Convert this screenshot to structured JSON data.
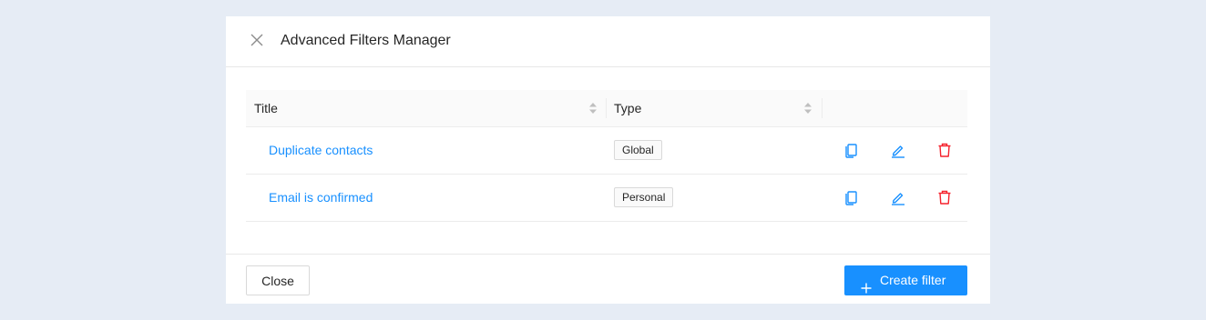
{
  "modal": {
    "title": "Advanced Filters Manager",
    "close_icon": "close-icon"
  },
  "table": {
    "columns": [
      {
        "label": "Title",
        "sortable": true
      },
      {
        "label": "Type",
        "sortable": true
      },
      {
        "label": ""
      }
    ],
    "rows": [
      {
        "title": "Duplicate contacts",
        "type": "Global"
      },
      {
        "title": "Email is confirmed",
        "type": "Personal"
      }
    ],
    "row_actions": [
      "copy-icon",
      "edit-icon",
      "delete-icon"
    ]
  },
  "footer": {
    "close_label": "Close",
    "create_label": "Create filter",
    "create_icon": "plus-icon"
  },
  "colors": {
    "background": "#e6ecf5",
    "primary": "#1890ff",
    "danger": "#f5222d",
    "link": "#1890ff"
  }
}
